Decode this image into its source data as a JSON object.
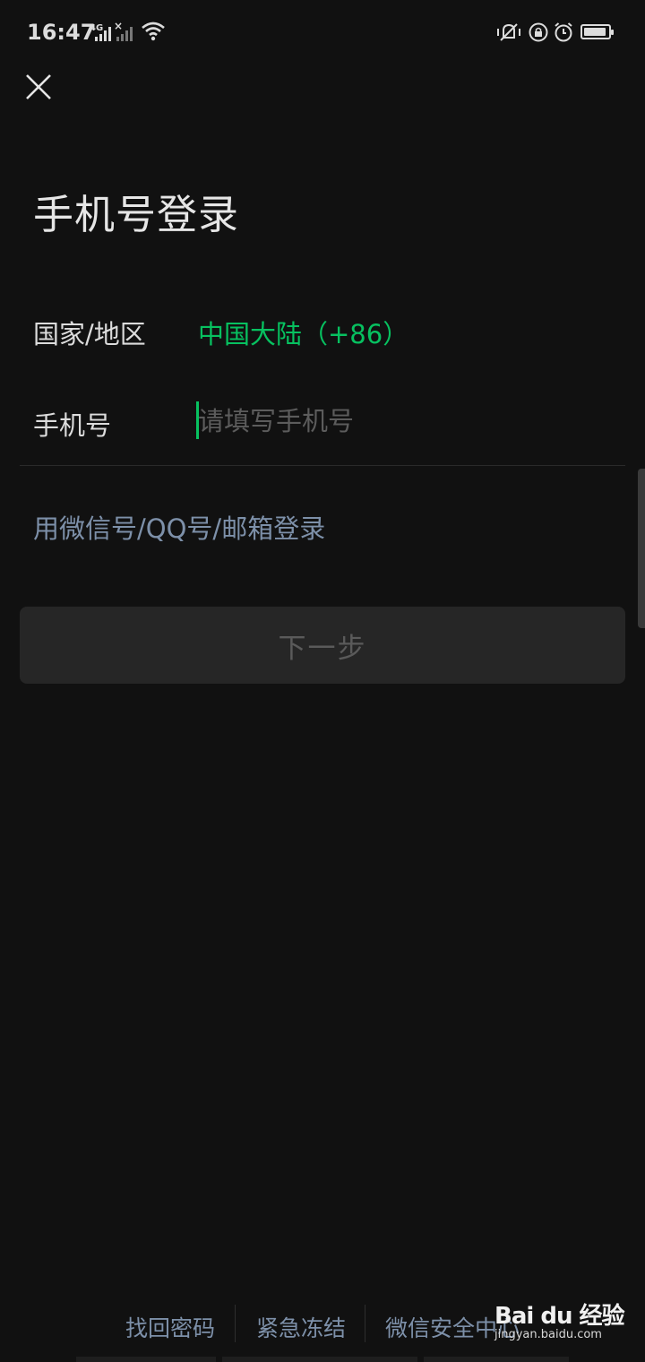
{
  "status_bar": {
    "time": "16:47",
    "network_type": "4G",
    "icons": [
      "signal-icon",
      "signal-no-service-icon",
      "wifi-icon",
      "vibrate-icon",
      "rotation-lock-icon",
      "alarm-icon",
      "battery-icon"
    ]
  },
  "header": {
    "close_icon": "close-icon",
    "title": "手机号登录"
  },
  "form": {
    "region_label": "国家/地区",
    "region_value": "中国大陆（+86）",
    "phone_label": "手机号",
    "phone_value": "",
    "phone_placeholder": "请填写手机号"
  },
  "alt_login": "用微信号/QQ号/邮箱登录",
  "next_button": "下一步",
  "footer": {
    "links": [
      "找回密码",
      "紧急冻结",
      "微信安全中心"
    ]
  },
  "watermark": {
    "brand": "Bai du 经验",
    "url": "jingyan.baidu.com"
  },
  "colors": {
    "background": "#111111",
    "accent_green": "#07c160",
    "link_blue_gray": "#7d90a9",
    "button_disabled_bg": "#262626"
  }
}
